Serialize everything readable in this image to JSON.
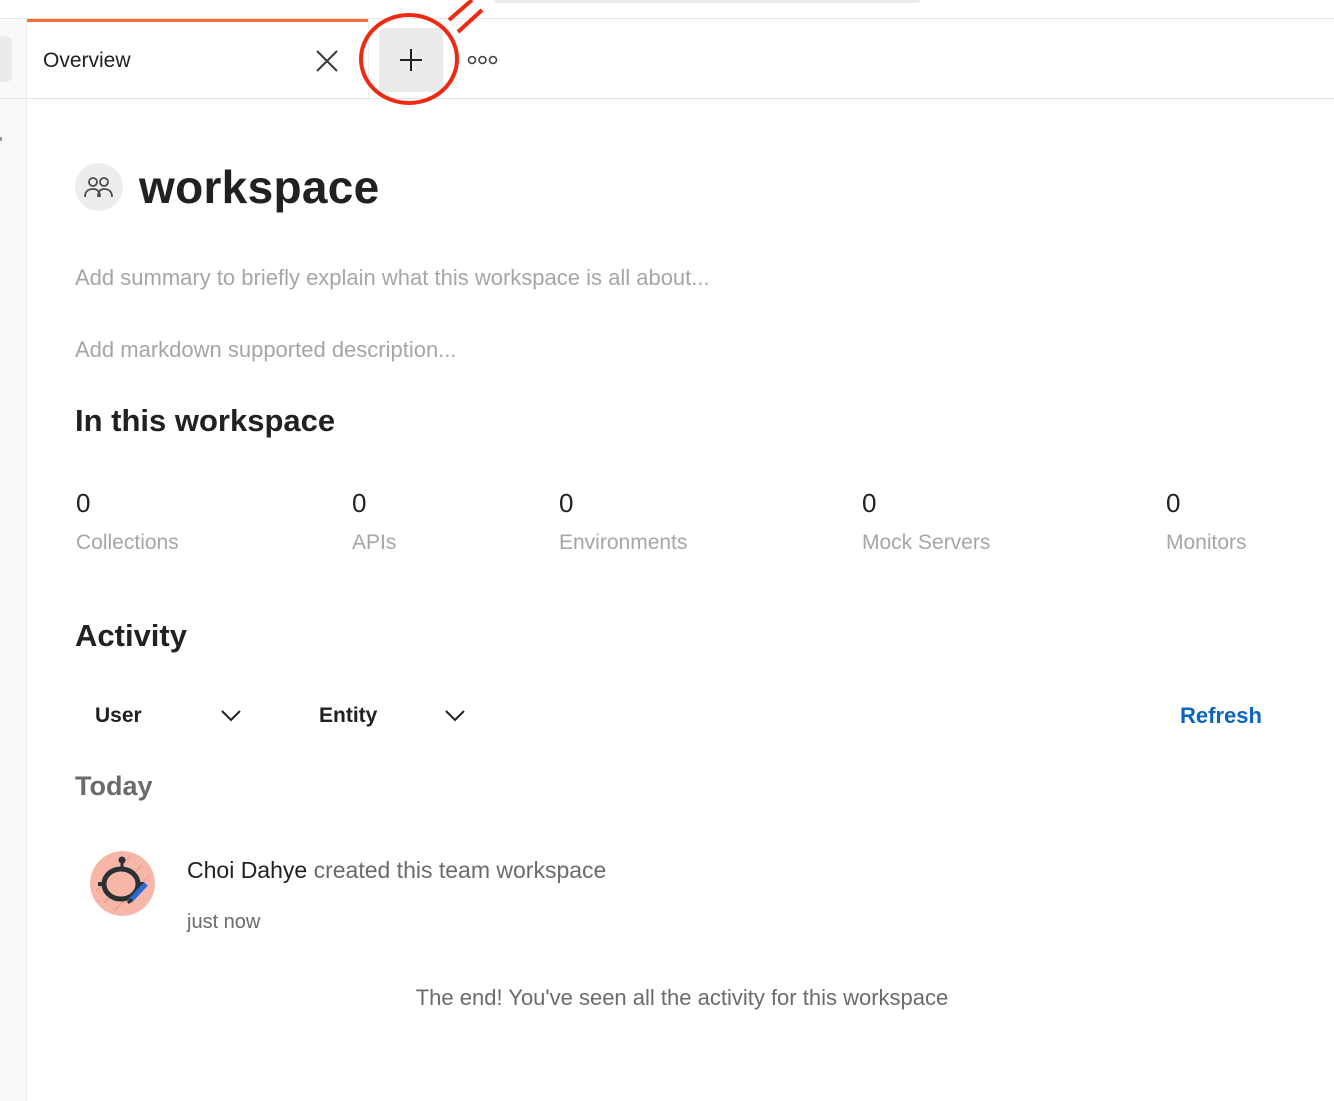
{
  "tabs": {
    "active_label": "Overview"
  },
  "workspace": {
    "title": "workspace",
    "summary_placeholder": "Add summary to briefly explain what this workspace is all about...",
    "description_placeholder": "Add markdown supported description..."
  },
  "in_workspace": {
    "heading": "In this workspace",
    "stats": [
      {
        "count": "0",
        "label": "Collections"
      },
      {
        "count": "0",
        "label": "APIs"
      },
      {
        "count": "0",
        "label": "Environments"
      },
      {
        "count": "0",
        "label": "Mock Servers"
      },
      {
        "count": "0",
        "label": "Monitors"
      }
    ]
  },
  "activity": {
    "heading": "Activity",
    "filter_user": "User",
    "filter_entity": "Entity",
    "refresh_label": "Refresh",
    "group_label": "Today",
    "items": [
      {
        "user": "Choi Dahye",
        "action": " created this team workspace",
        "time": "just now"
      }
    ],
    "end_message": "The end! You've seen all the activity for this workspace"
  },
  "colors": {
    "accent_tab": "#ff6c37",
    "link": "#0b65c2",
    "annotation": "#ee2a12"
  },
  "icons": [
    "close-icon",
    "plus-icon",
    "more-options-icon",
    "team-icon",
    "chevron-down-icon"
  ]
}
